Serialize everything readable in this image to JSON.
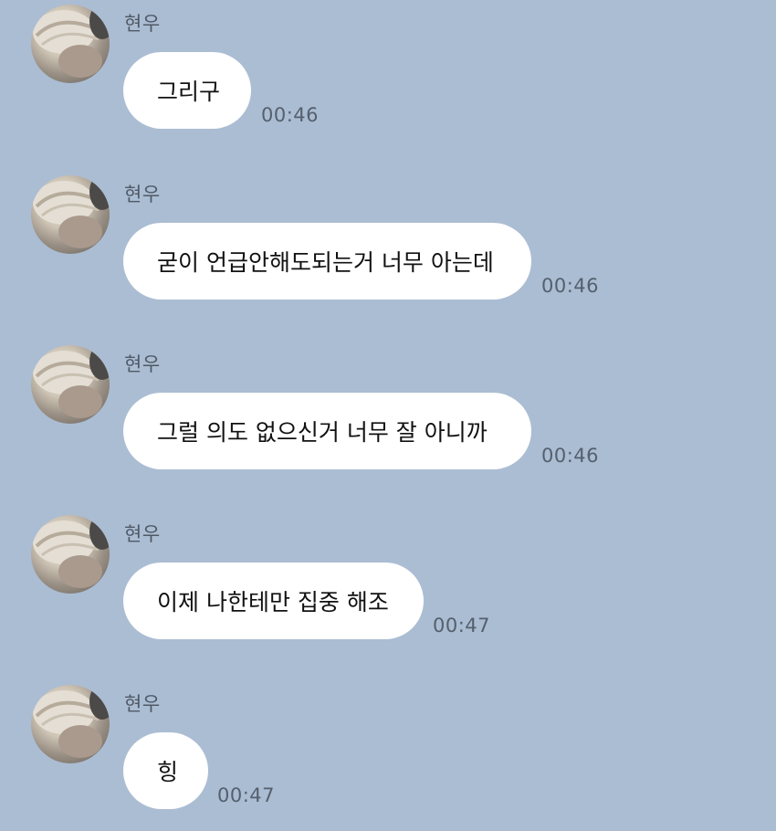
{
  "chat": {
    "messages": [
      {
        "sender": "현우",
        "text": "그리구",
        "time": "00:46"
      },
      {
        "sender": "현우",
        "text": "굳이 언급안해도되는거 너무 아는데",
        "time": "00:46"
      },
      {
        "sender": "현우",
        "text": "그럴 의도 없으신거 너무 잘 아니까",
        "time": "00:46"
      },
      {
        "sender": "현우",
        "text": "이제 나한테만 집중 해조",
        "time": "00:47"
      },
      {
        "sender": "현우",
        "text": "힝",
        "time": "00:47"
      }
    ]
  },
  "colors": {
    "background": "#abbdd3",
    "bubble": "#ffffff",
    "text": "#111111",
    "meta_text": "#55606d"
  }
}
